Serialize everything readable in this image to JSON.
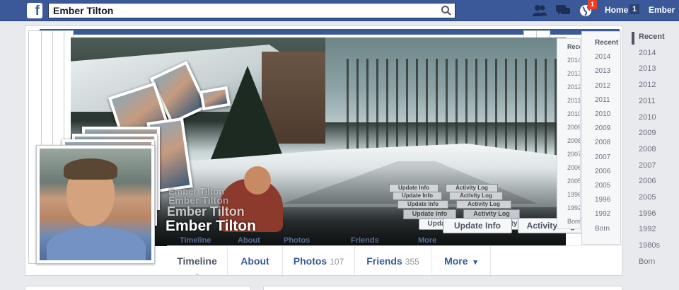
{
  "header": {
    "logo_letter": "f",
    "search_value": "Ember Tilton",
    "notification_count": "1",
    "home_label": "Home",
    "home_count": "1",
    "user_label": "Ember"
  },
  "profile": {
    "name": "Ember Tilton",
    "update_info_label": "Update Info",
    "activity_log_label": "Activity Log",
    "gear_symbol": "⚙ ▾"
  },
  "tabs": [
    {
      "label": "Timeline",
      "count": ""
    },
    {
      "label": "About",
      "count": ""
    },
    {
      "label": "Photos",
      "count": "107"
    },
    {
      "label": "Friends",
      "count": "355"
    },
    {
      "label": "More",
      "count": ""
    }
  ],
  "tab_more_arrow": "▾",
  "scrubber": {
    "years": [
      "Recent",
      "2014",
      "2013",
      "2012",
      "2011",
      "2010",
      "2009",
      "2008",
      "2007",
      "2006",
      "2005",
      "1996",
      "1992",
      "1980s",
      "Born"
    ],
    "inner_years": [
      "Recent",
      "2014",
      "2013",
      "2012",
      "2011",
      "2010",
      "2009",
      "2008",
      "2007",
      "2006",
      "2005",
      "1996",
      "1992",
      "Born"
    ]
  },
  "colors": {
    "brand_blue": "#3b5998",
    "badge_red": "#f03d25",
    "page_bg": "#e9eaed"
  },
  "icons": {
    "search": "search-icon",
    "friends": "friend-requests-icon",
    "messages": "messages-icon",
    "notifications": "globe-notifications-icon",
    "gear": "gear-icon"
  }
}
